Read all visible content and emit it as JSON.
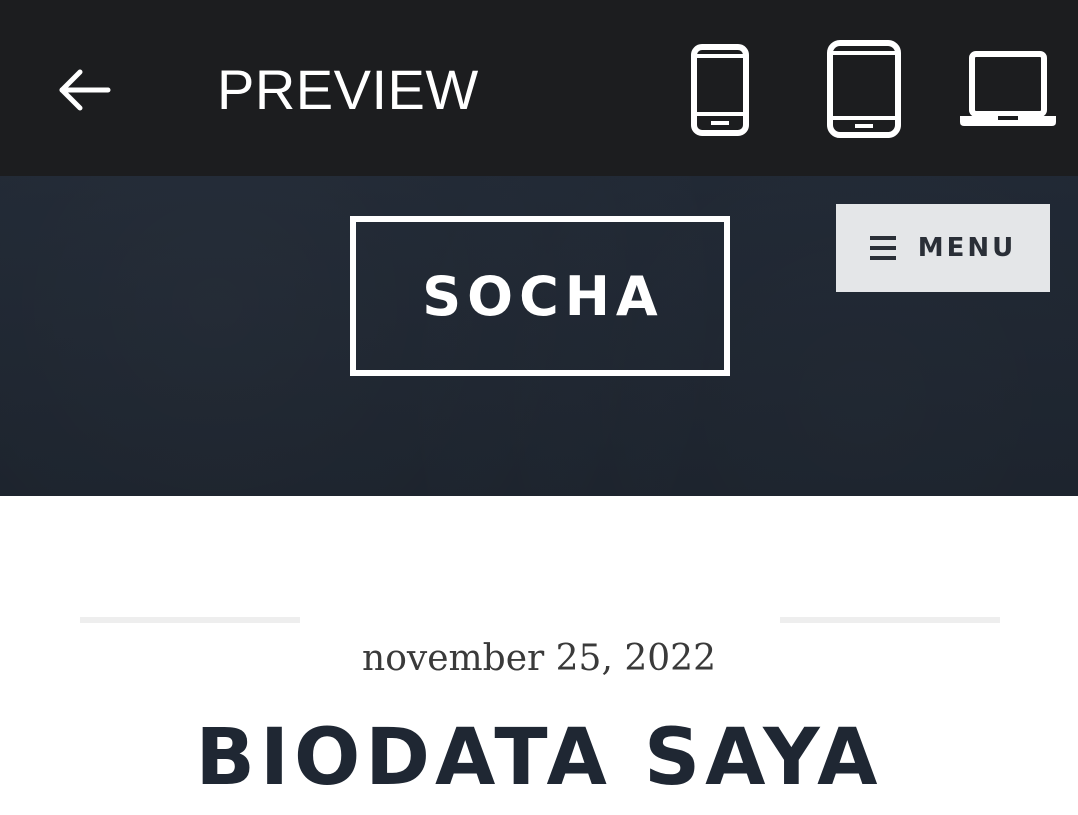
{
  "toolbar": {
    "title": "PREVIEW",
    "back_icon": "arrow-left-icon",
    "devices": [
      {
        "name": "phone",
        "icon": "mobile-icon"
      },
      {
        "name": "tablet",
        "icon": "tablet-icon"
      },
      {
        "name": "desktop",
        "icon": "laptop-icon"
      }
    ],
    "colors": {
      "background": "#1c1d1f",
      "foreground": "#ffffff"
    }
  },
  "site": {
    "logo_text": "SOCHA",
    "menu_label": "MENU",
    "menu_icon": "hamburger-icon",
    "colors": {
      "header_bg": "#1f2733",
      "menu_bg": "#e4e6e8"
    }
  },
  "post": {
    "date": "november 25, 2022",
    "title": "BIODATA SAYA"
  }
}
